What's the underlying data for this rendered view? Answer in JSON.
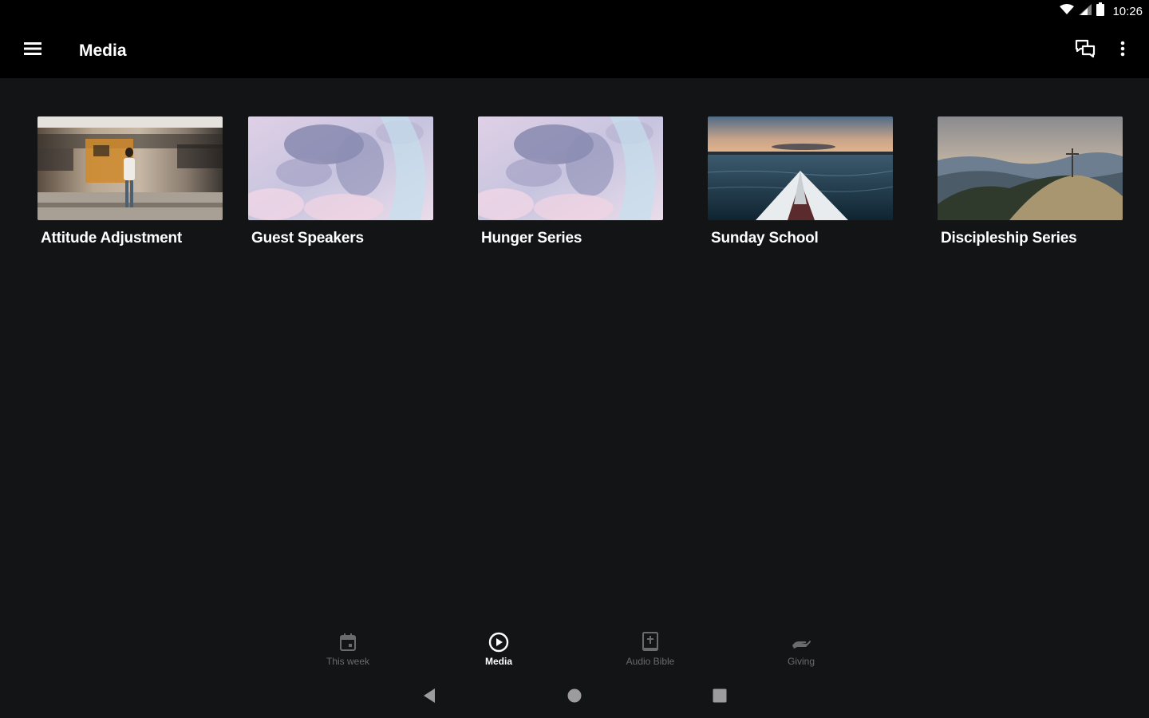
{
  "status_bar": {
    "time": "10:26",
    "icons": [
      "wifi-icon",
      "signal-icon",
      "battery-icon"
    ]
  },
  "app_bar": {
    "title": "Media",
    "icons": [
      "menu-icon",
      "chat-icon",
      "more-vert-icon"
    ]
  },
  "cards": [
    {
      "title": "Attitude Adjustment"
    },
    {
      "title": "Guest Speakers"
    },
    {
      "title": "Hunger Series"
    },
    {
      "title": "Sunday School"
    },
    {
      "title": "Discipleship Series"
    }
  ],
  "bottom_nav": {
    "items": [
      {
        "label": "This week",
        "icon": "calendar-icon",
        "active": false
      },
      {
        "label": "Media",
        "icon": "play-circle-icon",
        "active": true
      },
      {
        "label": "Audio Bible",
        "icon": "bible-icon",
        "active": false
      },
      {
        "label": "Giving",
        "icon": "giving-hand-icon",
        "active": false
      }
    ]
  },
  "system_nav": {
    "buttons": [
      "back-icon",
      "home-icon",
      "recents-icon"
    ]
  },
  "colors": {
    "background": "#131416",
    "bar": "#000000",
    "text": "#ffffff",
    "inactive_nav": "#6a6b6e"
  }
}
